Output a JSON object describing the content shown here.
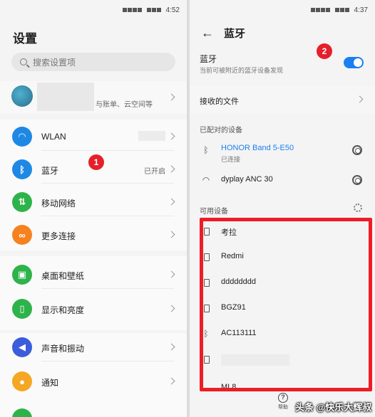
{
  "left": {
    "status_time": "4:52",
    "title": "设置",
    "search_placeholder": "搜索设置项",
    "account_subtitle": "与账单、云空间等",
    "rows": [
      {
        "label": "WLAN",
        "value": ""
      },
      {
        "label": "蓝牙",
        "value": "已开启"
      },
      {
        "label": "移动网络",
        "value": ""
      },
      {
        "label": "更多连接",
        "value": ""
      },
      {
        "label": "桌面和壁纸",
        "value": ""
      },
      {
        "label": "显示和亮度",
        "value": ""
      },
      {
        "label": "声音和振动",
        "value": ""
      },
      {
        "label": "通知",
        "value": ""
      }
    ],
    "badge": "1"
  },
  "right": {
    "status_time": "4:37",
    "title": "蓝牙",
    "bluetooth_label": "蓝牙",
    "bluetooth_desc": "当前可被附近的蓝牙设备发现",
    "bluetooth_on": true,
    "received_files": "接收的文件",
    "paired_header": "已配对的设备",
    "paired": [
      {
        "name": "HONOR Band 5-E50",
        "status": "已连接"
      },
      {
        "name": "dyplay ANC 30",
        "status": ""
      }
    ],
    "available_header": "可用设备",
    "available": [
      "考拉",
      "Redmi",
      "dddddddd",
      "BGZ91",
      "AC113111",
      "",
      "MI 8"
    ],
    "badge": "2"
  },
  "footer": {
    "help": "帮助",
    "watermark": "头条 @快乐大辉叔"
  },
  "colors": {
    "accent": "#1a7ff0",
    "highlight": "#ee1c25",
    "wifi": "#1e88e5",
    "bluetooth": "#1e88e5",
    "mobile": "#2db34a",
    "more": "#f5821f",
    "wallpaper": "#2db34a",
    "display": "#2db34a",
    "sound": "#3b5ddc",
    "notify": "#f5a623"
  }
}
